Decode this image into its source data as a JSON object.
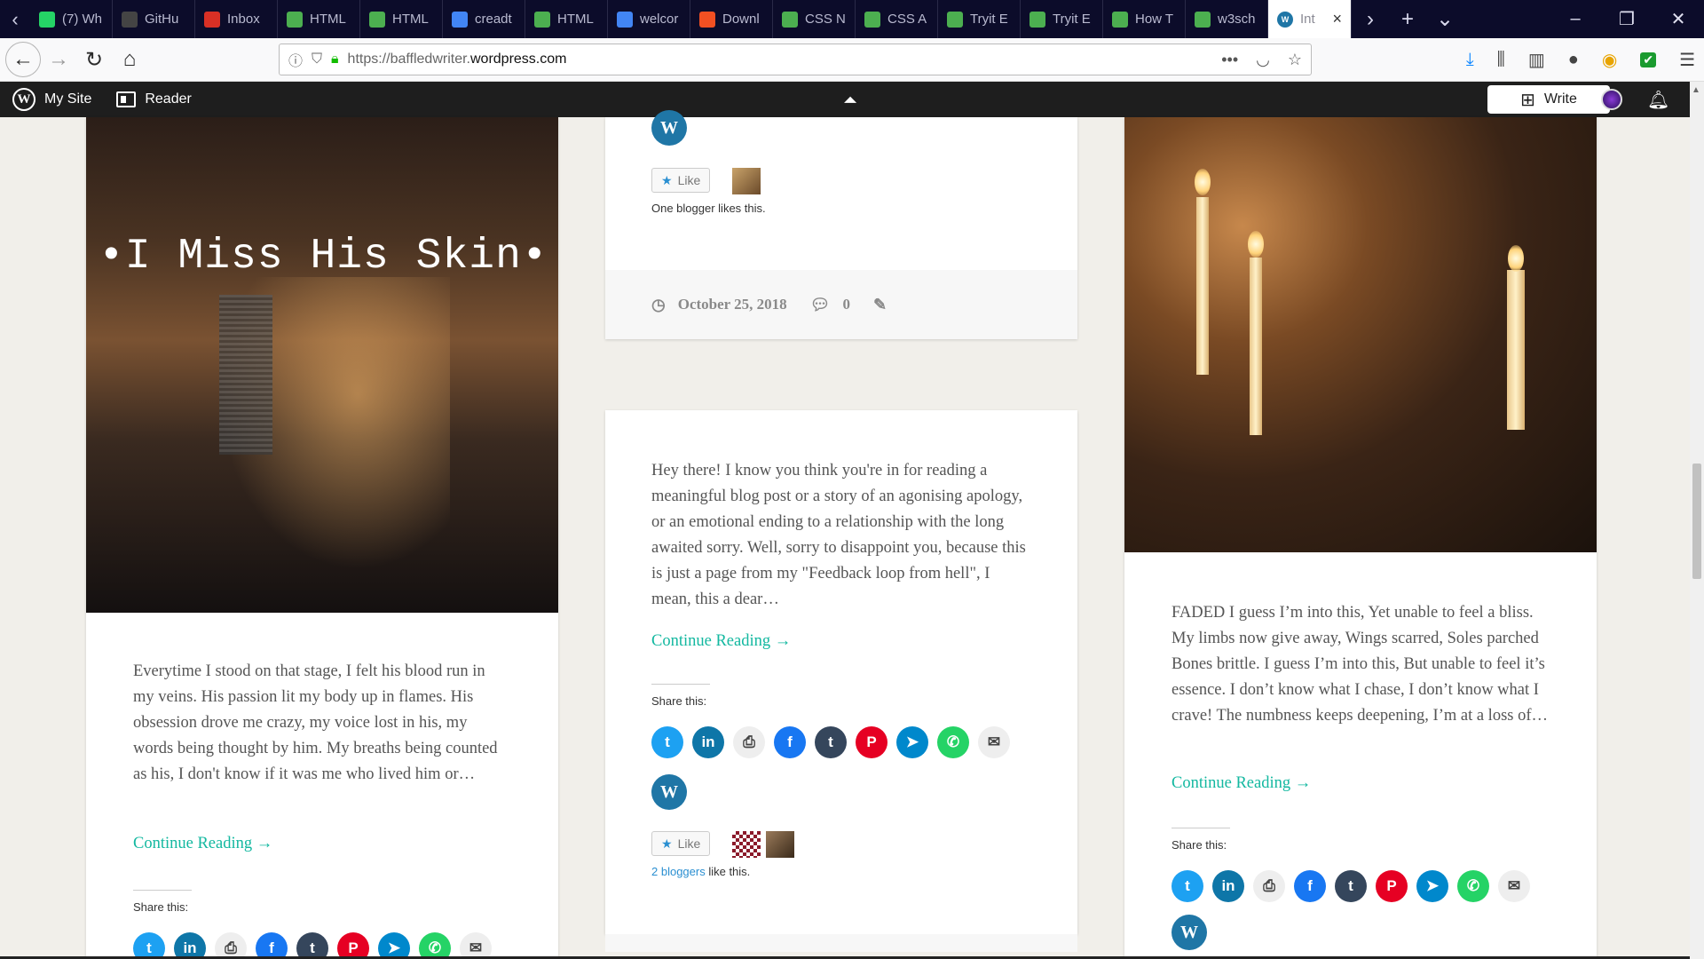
{
  "browser": {
    "tabs": [
      {
        "label": "(7) Wh",
        "icon": "whatsapp-icon",
        "color": "#25d366"
      },
      {
        "label": "GitHu",
        "icon": "github-icon",
        "color": "#444444"
      },
      {
        "label": "Inbox",
        "icon": "gmail-icon",
        "color": "#d93025"
      },
      {
        "label": "HTML",
        "icon": "w3schools-icon",
        "color": "#4caf50"
      },
      {
        "label": "HTML",
        "icon": "w3schools-icon",
        "color": "#4caf50"
      },
      {
        "label": "creadt",
        "icon": "google-icon",
        "color": "#4285f4"
      },
      {
        "label": "HTML",
        "icon": "w3schools-icon",
        "color": "#4caf50"
      },
      {
        "label": "welcor",
        "icon": "google-icon",
        "color": "#4285f4"
      },
      {
        "label": "Downl",
        "icon": "microsoft-icon",
        "color": "#f25022"
      },
      {
        "label": "CSS N",
        "icon": "w3schools-icon",
        "color": "#4caf50"
      },
      {
        "label": "CSS A",
        "icon": "w3schools-icon",
        "color": "#4caf50"
      },
      {
        "label": "Tryit E",
        "icon": "w3schools-icon",
        "color": "#4caf50"
      },
      {
        "label": "Tryit E",
        "icon": "w3schools-icon",
        "color": "#4caf50"
      },
      {
        "label": "How T",
        "icon": "w3schools-icon",
        "color": "#4caf50"
      },
      {
        "label": "w3sch",
        "icon": "w3schools-icon",
        "color": "#4caf50"
      }
    ],
    "active_tab": {
      "label": "Int",
      "icon": "wordpress-icon"
    },
    "url_prefix": "https://baffledwriter.",
    "url_host": "wordpress.com"
  },
  "wpbar": {
    "mysite": "My Site",
    "reader": "Reader",
    "write": "Write"
  },
  "posts": {
    "left": {
      "image_title": "•I Miss His Skin•",
      "excerpt": "Everytime I stood on that stage, I felt his blood run in my veins. His passion lit my body up in flames. His obsession drove me crazy, my voice lost in his, my words being thought by him. My breaths being counted as his, I don't know if it was me who lived him or…",
      "continue": "Continue Reading →",
      "share_label": "Share this:"
    },
    "middle_top": {
      "like": "Like",
      "likes_text": "One blogger likes this.",
      "date": "October 25, 2018",
      "comments": "0"
    },
    "middle": {
      "excerpt": "Hey there! I know you think you're in for reading a meaningful blog post or a story of an agonising apology, or an emotional ending to a relationship with the long awaited sorry. Well, sorry to disappoint you, because this is just a page from my \"Feedback loop from hell\", I mean, this a dear…",
      "continue": "Continue Reading →",
      "share_label": "Share this:",
      "like": "Like",
      "likes_link": "2 bloggers",
      "likes_rest": " like this."
    },
    "right": {
      "excerpt": "FADED I guess I’m into this, Yet unable to feel a bliss. My limbs now give away, Wings scarred, Soles parched Bones brittle. I guess I’m into this, But unable to feel it’s essence. I don’t know what I chase, I don’t know what I crave! The numbness keeps deepening, I’m at a loss of…",
      "continue": "Continue Reading →",
      "share_label": "Share this:"
    }
  },
  "share_icons": [
    {
      "name": "twitter",
      "glyph": "t",
      "color": "#1da1f2"
    },
    {
      "name": "linkedin",
      "glyph": "in",
      "color": "#0e76a8"
    },
    {
      "name": "print",
      "glyph": "⎙",
      "color": "#eeeeee"
    },
    {
      "name": "facebook",
      "glyph": "f",
      "color": "#1877f2"
    },
    {
      "name": "tumblr",
      "glyph": "t",
      "color": "#35465c"
    },
    {
      "name": "pinterest",
      "glyph": "P",
      "color": "#e60023"
    },
    {
      "name": "telegram",
      "glyph": "➤",
      "color": "#0088cc"
    },
    {
      "name": "whatsapp",
      "glyph": "✆",
      "color": "#25d366"
    },
    {
      "name": "email",
      "glyph": "✉",
      "color": "#eeeeee"
    }
  ]
}
